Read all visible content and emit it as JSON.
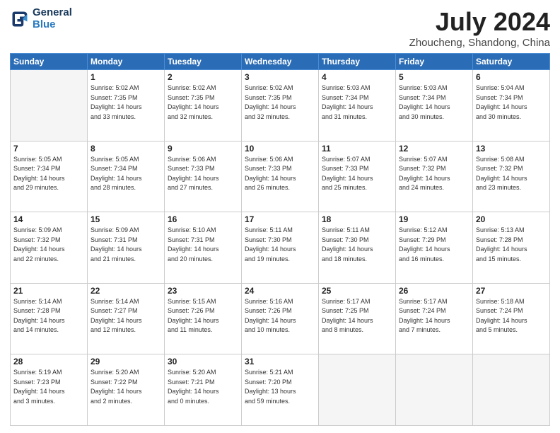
{
  "header": {
    "logo_line1": "General",
    "logo_line2": "Blue",
    "month": "July 2024",
    "location": "Zhoucheng, Shandong, China"
  },
  "weekdays": [
    "Sunday",
    "Monday",
    "Tuesday",
    "Wednesday",
    "Thursday",
    "Friday",
    "Saturday"
  ],
  "weeks": [
    [
      {
        "day": "",
        "info": ""
      },
      {
        "day": "1",
        "info": "Sunrise: 5:02 AM\nSunset: 7:35 PM\nDaylight: 14 hours\nand 33 minutes."
      },
      {
        "day": "2",
        "info": "Sunrise: 5:02 AM\nSunset: 7:35 PM\nDaylight: 14 hours\nand 32 minutes."
      },
      {
        "day": "3",
        "info": "Sunrise: 5:02 AM\nSunset: 7:35 PM\nDaylight: 14 hours\nand 32 minutes."
      },
      {
        "day": "4",
        "info": "Sunrise: 5:03 AM\nSunset: 7:34 PM\nDaylight: 14 hours\nand 31 minutes."
      },
      {
        "day": "5",
        "info": "Sunrise: 5:03 AM\nSunset: 7:34 PM\nDaylight: 14 hours\nand 30 minutes."
      },
      {
        "day": "6",
        "info": "Sunrise: 5:04 AM\nSunset: 7:34 PM\nDaylight: 14 hours\nand 30 minutes."
      }
    ],
    [
      {
        "day": "7",
        "info": "Sunrise: 5:05 AM\nSunset: 7:34 PM\nDaylight: 14 hours\nand 29 minutes."
      },
      {
        "day": "8",
        "info": "Sunrise: 5:05 AM\nSunset: 7:34 PM\nDaylight: 14 hours\nand 28 minutes."
      },
      {
        "day": "9",
        "info": "Sunrise: 5:06 AM\nSunset: 7:33 PM\nDaylight: 14 hours\nand 27 minutes."
      },
      {
        "day": "10",
        "info": "Sunrise: 5:06 AM\nSunset: 7:33 PM\nDaylight: 14 hours\nand 26 minutes."
      },
      {
        "day": "11",
        "info": "Sunrise: 5:07 AM\nSunset: 7:33 PM\nDaylight: 14 hours\nand 25 minutes."
      },
      {
        "day": "12",
        "info": "Sunrise: 5:07 AM\nSunset: 7:32 PM\nDaylight: 14 hours\nand 24 minutes."
      },
      {
        "day": "13",
        "info": "Sunrise: 5:08 AM\nSunset: 7:32 PM\nDaylight: 14 hours\nand 23 minutes."
      }
    ],
    [
      {
        "day": "14",
        "info": "Sunrise: 5:09 AM\nSunset: 7:32 PM\nDaylight: 14 hours\nand 22 minutes."
      },
      {
        "day": "15",
        "info": "Sunrise: 5:09 AM\nSunset: 7:31 PM\nDaylight: 14 hours\nand 21 minutes."
      },
      {
        "day": "16",
        "info": "Sunrise: 5:10 AM\nSunset: 7:31 PM\nDaylight: 14 hours\nand 20 minutes."
      },
      {
        "day": "17",
        "info": "Sunrise: 5:11 AM\nSunset: 7:30 PM\nDaylight: 14 hours\nand 19 minutes."
      },
      {
        "day": "18",
        "info": "Sunrise: 5:11 AM\nSunset: 7:30 PM\nDaylight: 14 hours\nand 18 minutes."
      },
      {
        "day": "19",
        "info": "Sunrise: 5:12 AM\nSunset: 7:29 PM\nDaylight: 14 hours\nand 16 minutes."
      },
      {
        "day": "20",
        "info": "Sunrise: 5:13 AM\nSunset: 7:28 PM\nDaylight: 14 hours\nand 15 minutes."
      }
    ],
    [
      {
        "day": "21",
        "info": "Sunrise: 5:14 AM\nSunset: 7:28 PM\nDaylight: 14 hours\nand 14 minutes."
      },
      {
        "day": "22",
        "info": "Sunrise: 5:14 AM\nSunset: 7:27 PM\nDaylight: 14 hours\nand 12 minutes."
      },
      {
        "day": "23",
        "info": "Sunrise: 5:15 AM\nSunset: 7:26 PM\nDaylight: 14 hours\nand 11 minutes."
      },
      {
        "day": "24",
        "info": "Sunrise: 5:16 AM\nSunset: 7:26 PM\nDaylight: 14 hours\nand 10 minutes."
      },
      {
        "day": "25",
        "info": "Sunrise: 5:17 AM\nSunset: 7:25 PM\nDaylight: 14 hours\nand 8 minutes."
      },
      {
        "day": "26",
        "info": "Sunrise: 5:17 AM\nSunset: 7:24 PM\nDaylight: 14 hours\nand 7 minutes."
      },
      {
        "day": "27",
        "info": "Sunrise: 5:18 AM\nSunset: 7:24 PM\nDaylight: 14 hours\nand 5 minutes."
      }
    ],
    [
      {
        "day": "28",
        "info": "Sunrise: 5:19 AM\nSunset: 7:23 PM\nDaylight: 14 hours\nand 3 minutes."
      },
      {
        "day": "29",
        "info": "Sunrise: 5:20 AM\nSunset: 7:22 PM\nDaylight: 14 hours\nand 2 minutes."
      },
      {
        "day": "30",
        "info": "Sunrise: 5:20 AM\nSunset: 7:21 PM\nDaylight: 14 hours\nand 0 minutes."
      },
      {
        "day": "31",
        "info": "Sunrise: 5:21 AM\nSunset: 7:20 PM\nDaylight: 13 hours\nand 59 minutes."
      },
      {
        "day": "",
        "info": ""
      },
      {
        "day": "",
        "info": ""
      },
      {
        "day": "",
        "info": ""
      }
    ]
  ]
}
